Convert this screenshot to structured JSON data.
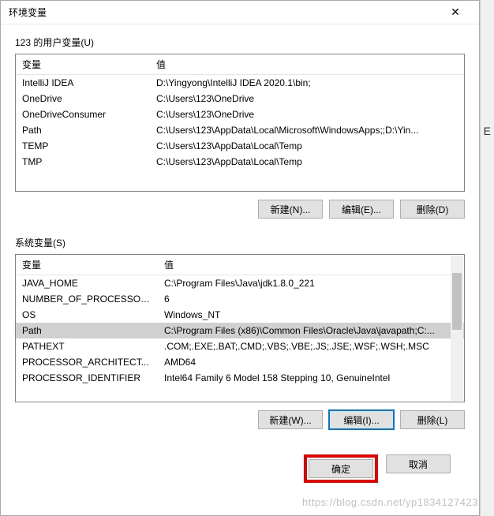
{
  "titlebar": {
    "title": "环境变量",
    "close": "✕"
  },
  "userSection": {
    "label": "123 的用户变量(U)",
    "headers": {
      "var": "变量",
      "val": "值"
    },
    "rows": [
      {
        "var": "IntelliJ IDEA",
        "val": "D:\\Yingyong\\IntelliJ IDEA 2020.1\\bin;"
      },
      {
        "var": "OneDrive",
        "val": "C:\\Users\\123\\OneDrive"
      },
      {
        "var": "OneDriveConsumer",
        "val": "C:\\Users\\123\\OneDrive"
      },
      {
        "var": "Path",
        "val": "C:\\Users\\123\\AppData\\Local\\Microsoft\\WindowsApps;;D:\\Yin..."
      },
      {
        "var": "TEMP",
        "val": "C:\\Users\\123\\AppData\\Local\\Temp"
      },
      {
        "var": "TMP",
        "val": "C:\\Users\\123\\AppData\\Local\\Temp"
      }
    ],
    "buttons": {
      "new": "新建(N)...",
      "edit": "编辑(E)...",
      "delete": "删除(D)"
    }
  },
  "systemSection": {
    "label": "系统变量(S)",
    "headers": {
      "var": "变量",
      "val": "值"
    },
    "rows": [
      {
        "var": "JAVA_HOME",
        "val": "C:\\Program Files\\Java\\jdk1.8.0_221"
      },
      {
        "var": "NUMBER_OF_PROCESSORS",
        "val": "6"
      },
      {
        "var": "OS",
        "val": "Windows_NT"
      },
      {
        "var": "Path",
        "val": "C:\\Program Files (x86)\\Common Files\\Oracle\\Java\\javapath;C:..."
      },
      {
        "var": "PATHEXT",
        "val": ".COM;.EXE;.BAT;.CMD;.VBS;.VBE;.JS;.JSE;.WSF;.WSH;.MSC"
      },
      {
        "var": "PROCESSOR_ARCHITECT...",
        "val": "AMD64"
      },
      {
        "var": "PROCESSOR_IDENTIFIER",
        "val": "Intel64 Family 6 Model 158 Stepping 10, GenuineIntel"
      }
    ],
    "selectedIndex": 3,
    "buttons": {
      "new": "新建(W)...",
      "edit": "编辑(I)...",
      "delete": "删除(L)"
    }
  },
  "bottom": {
    "ok": "确定",
    "cancel": "取消"
  },
  "side": {
    "letter": "E"
  },
  "watermark": "https://blog.csdn.net/yp1834127423"
}
